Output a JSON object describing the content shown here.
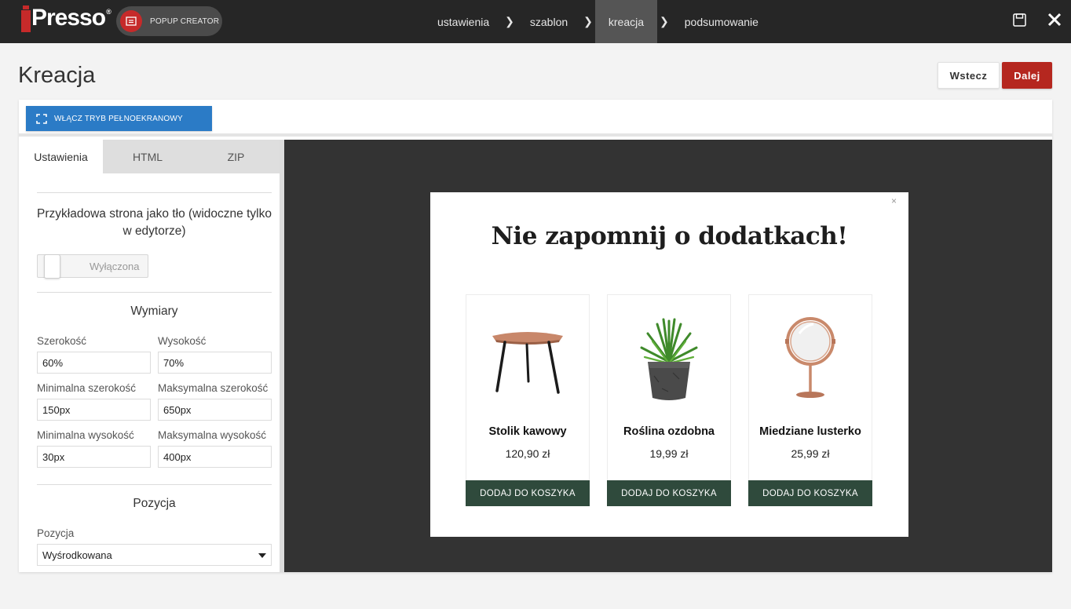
{
  "app": {
    "logo_text": "Presso",
    "logo_mark": "®",
    "creator_label": "POPUP CREATOR"
  },
  "steps": [
    {
      "label": "ustawienia",
      "active": false
    },
    {
      "label": "szablon",
      "active": false
    },
    {
      "label": "kreacja",
      "active": true
    },
    {
      "label": "podsumowanie",
      "active": false
    }
  ],
  "header": {
    "title": "Kreacja",
    "back_label": "Wstecz",
    "next_label": "Dalej"
  },
  "toolbar": {
    "fullscreen_label": "WŁĄCZ TRYB PEŁNOEKRANOWY"
  },
  "sidebar": {
    "tabs": [
      "Ustawienia",
      "HTML",
      "ZIP"
    ],
    "background_section": {
      "title": "Przykładowa strona jako tło (widoczne tylko w edytorze)",
      "toggle_label": "Wyłączona"
    },
    "dimensions": {
      "title": "Wymiary",
      "width_label": "Szerokość",
      "width_value": "60%",
      "height_label": "Wysokość",
      "height_value": "70%",
      "min_width_label": "Minimalna szerokość",
      "min_width_value": "150px",
      "max_width_label": "Maksymalna szerokość",
      "max_width_value": "650px",
      "min_height_label": "Minimalna wysokość",
      "min_height_value": "30px",
      "max_height_label": "Maksymalna wysokość",
      "max_height_value": "400px"
    },
    "position": {
      "title": "Pozycja",
      "label": "Pozycja",
      "selected": "Wyśrodkowana"
    }
  },
  "popup": {
    "close": "×",
    "title": "Nie zapomnij o dodatkach!",
    "products": [
      {
        "name": "Stolik kawowy",
        "price": "120,90 zł",
        "button": "DODAJ DO KOSZYKA",
        "icon": "coffee-table-image"
      },
      {
        "name": "Roślina ozdobna",
        "price": "19,99 zł",
        "button": "DODAJ DO KOSZYKA",
        "icon": "plant-image"
      },
      {
        "name": "Miedziane lusterko",
        "price": "25,99 zł",
        "button": "DODAJ DO KOSZYKA",
        "icon": "mirror-image"
      }
    ]
  },
  "colors": {
    "topbar": "#262626",
    "brand_red": "#c62a2a",
    "next_button": "#b5271f",
    "fullscreen_button": "#2b7bc6",
    "add_to_cart": "#2f4a3c"
  }
}
